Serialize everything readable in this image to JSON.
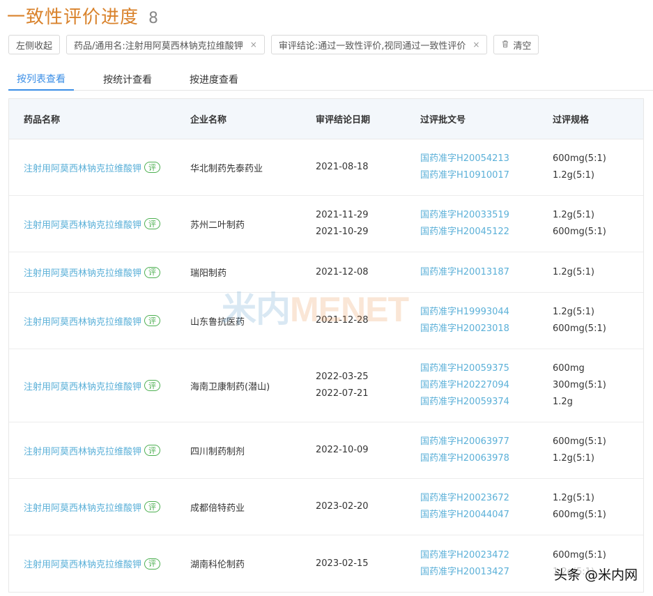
{
  "header": {
    "title": "一致性评价进度",
    "count": "8"
  },
  "filters": {
    "collapse_label": "左侧收起",
    "chips": [
      {
        "label": "药品/通用名:注射用阿莫西林钠克拉维酸钾",
        "close": "×"
      },
      {
        "label": "审评结论:通过一致性评价,视同通过一致性评价",
        "close": "×"
      }
    ],
    "clear_label": "清空",
    "clear_icon": "trash-icon"
  },
  "tabs": [
    {
      "label": "按列表查看",
      "active": true
    },
    {
      "label": "按统计查看",
      "active": false
    },
    {
      "label": "按进度查看",
      "active": false
    }
  ],
  "table": {
    "columns": [
      "药品名称",
      "企业名称",
      "审评结论日期",
      "过评批文号",
      "过评规格"
    ],
    "badge_label": "评",
    "rows": [
      {
        "drug": "注射用阿莫西林钠克拉维酸钾",
        "company": "华北制药先泰药业",
        "dates": [
          "2021-08-18"
        ],
        "approvals": [
          "国药准字H20054213",
          "国药准字H10910017"
        ],
        "specs": [
          "600mg(5:1)",
          "1.2g(5:1)"
        ]
      },
      {
        "drug": "注射用阿莫西林钠克拉维酸钾",
        "company": "苏州二叶制药",
        "dates": [
          "2021-11-29",
          "2021-10-29"
        ],
        "approvals": [
          "国药准字H20033519",
          "国药准字H20045122"
        ],
        "specs": [
          "1.2g(5:1)",
          "600mg(5:1)"
        ]
      },
      {
        "drug": "注射用阿莫西林钠克拉维酸钾",
        "company": "瑞阳制药",
        "dates": [
          "2021-12-08"
        ],
        "approvals": [
          "国药准字H20013187"
        ],
        "specs": [
          "1.2g(5:1)"
        ]
      },
      {
        "drug": "注射用阿莫西林钠克拉维酸钾",
        "company": "山东鲁抗医药",
        "dates": [
          "2021-12-28"
        ],
        "approvals": [
          "国药准字H19993044",
          "国药准字H20023018"
        ],
        "specs": [
          "1.2g(5:1)",
          "600mg(5:1)"
        ]
      },
      {
        "drug": "注射用阿莫西林钠克拉维酸钾",
        "company": "海南卫康制药(潜山)",
        "dates": [
          "2022-03-25",
          "2022-07-21"
        ],
        "approvals": [
          "国药准字H20059375",
          "国药准字H20227094",
          "国药准字H20059374"
        ],
        "specs": [
          "600mg",
          "300mg(5:1)",
          "1.2g"
        ]
      },
      {
        "drug": "注射用阿莫西林钠克拉维酸钾",
        "company": "四川制药制剂",
        "dates": [
          "2022-10-09"
        ],
        "approvals": [
          "国药准字H20063977",
          "国药准字H20063978"
        ],
        "specs": [
          "600mg(5:1)",
          "1.2g(5:1)"
        ]
      },
      {
        "drug": "注射用阿莫西林钠克拉维酸钾",
        "company": "成都倍特药业",
        "dates": [
          "2023-02-20"
        ],
        "approvals": [
          "国药准字H20023672",
          "国药准字H20044047"
        ],
        "specs": [
          "1.2g(5:1)",
          "600mg(5:1)"
        ]
      },
      {
        "drug": "注射用阿莫西林钠克拉维酸钾",
        "company": "湖南科伦制药",
        "dates": [
          "2023-02-15"
        ],
        "approvals": [
          "国药准字H20023472",
          "国药准字H20013427"
        ],
        "specs": [
          "600mg(5:1)",
          "1.2g(5:1)"
        ]
      }
    ]
  },
  "watermark": {
    "cn": "米内",
    "en": "MENET"
  },
  "credit": "头条 @米内网"
}
